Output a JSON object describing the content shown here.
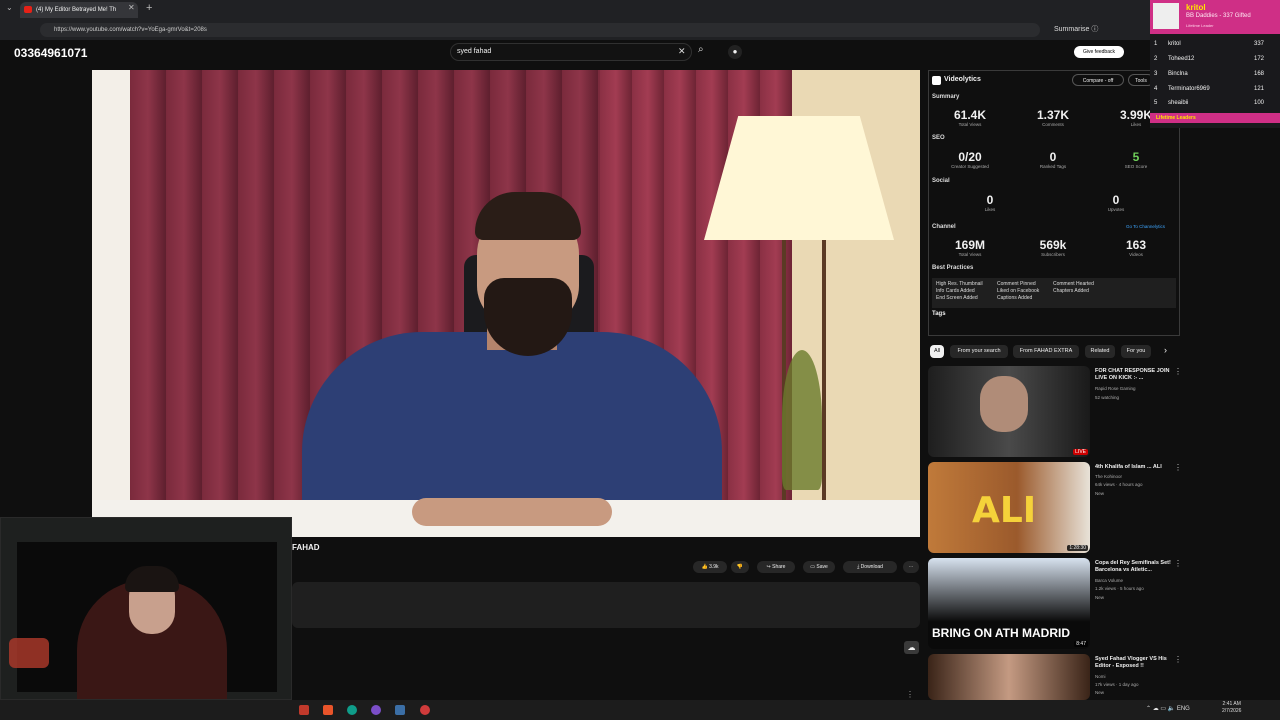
{
  "browser": {
    "tab_title": "(4) My Editor Betrayed Me! Th",
    "url": "https://www.youtube.com/watch?v=YoEga-gmrVo&t=208s",
    "summarise_label": "Summarise"
  },
  "overlay_phone": "03364961071",
  "search": {
    "query": "syed fahad"
  },
  "feedback_label": "Give feedback",
  "video": {
    "title_fragment": "FAHAD",
    "actions": {
      "likes": "3.9k",
      "share": "Share",
      "save": "Save",
      "download": "Download"
    }
  },
  "videolytics": {
    "brand": "Videolytics",
    "compare": "Compare - off",
    "tools": "Tools",
    "summary_label": "Summary",
    "summary": [
      {
        "value": "61.4K",
        "label": "Total Views"
      },
      {
        "value": "1.37K",
        "label": "Comments"
      },
      {
        "value": "3.99K",
        "label": "Likes"
      }
    ],
    "seo_label": "SEO",
    "seo": [
      {
        "value": "0/20",
        "label": "Creator Suggested"
      },
      {
        "value": "0",
        "label": "Ranked Tags"
      },
      {
        "value": "5",
        "label": "SEO Score"
      }
    ],
    "social_label": "Social",
    "social": [
      {
        "value": "0",
        "label": "Likes"
      },
      {
        "value": "0",
        "label": "Upvotes"
      }
    ],
    "channel_label": "Channel",
    "channel_link": "Go To Channelytics",
    "channel": [
      {
        "value": "169M",
        "label": "Total Views"
      },
      {
        "value": "569k",
        "label": "Subscribers"
      },
      {
        "value": "163",
        "label": "Videos"
      }
    ],
    "best_practices_label": "Best Practices",
    "best_practices": [
      "High Res. Thumbnail",
      "Comment Pinned",
      "Comment Hearted",
      "Info Cards Added",
      "Liked on Facebook",
      "Chapters Added",
      "End Screen Added",
      "Captions Added"
    ],
    "tags_label": "Tags"
  },
  "chips": [
    "All",
    "From your search",
    "From FAHAD EXTRA",
    "Related",
    "For you"
  ],
  "recommendations": [
    {
      "title": "FOR CHAT RESPONSE JOIN LIVE ON KICK :- ...",
      "channel": "Rapid Rose Gaming",
      "meta": "52 watching",
      "badge": "LIVE"
    },
    {
      "title": "4th Khalifa of Islam ... ALI",
      "channel": "The Kohinoor",
      "meta": "64k views · 4 hours ago",
      "badge": "1:28:30",
      "tag": "New",
      "thumb_text": "ALI"
    },
    {
      "title": "Copa del Rey Semifinals Set! Barcelona vs Atletic...",
      "channel": "Barca Volume",
      "meta": "1.2k views · 5 hours ago",
      "badge": "8:47",
      "tag": "New",
      "thumb_text": "BRING ON ATH MADRID"
    },
    {
      "title": "Syed Fahad Vlogger VS His Editor - Exposed !!",
      "channel": "Nomi",
      "meta": "17k views · 1 day ago",
      "tag": "New"
    }
  ],
  "leaderboard": {
    "top_name": "kritol",
    "top_sub": "BB Daddies - 337 Gifted",
    "top_caption": "Lifetime Leader",
    "rows": [
      {
        "rank": "1",
        "name": "kritol",
        "count": "337"
      },
      {
        "rank": "2",
        "name": "Toheed12",
        "count": "172"
      },
      {
        "rank": "3",
        "name": "Binclna",
        "count": "168"
      },
      {
        "rank": "4",
        "name": "Terminator6969",
        "count": "121"
      },
      {
        "rank": "5",
        "name": "sheaibii",
        "count": "100"
      }
    ],
    "footer": "Lifetime Leaders"
  },
  "taskbar": {
    "lang": "ENG",
    "time": "2:41 AM",
    "date": "2/7/2026"
  }
}
